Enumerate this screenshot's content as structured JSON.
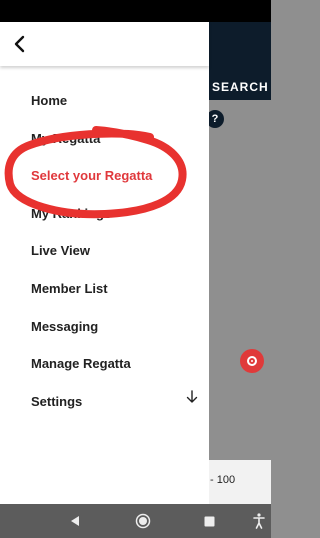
{
  "background": {
    "search_label": "SEARCH",
    "help_icon_text": "?",
    "scale_label": "- 100",
    "accent_color": "#e03a3a",
    "header_color": "#0d1c2b"
  },
  "drawer": {
    "back_icon": "chevron-left-icon",
    "items": [
      {
        "label": "Home"
      },
      {
        "label": "My Regatta"
      },
      {
        "label": "Select your Regatta",
        "active": true
      },
      {
        "label": "My Rankings"
      },
      {
        "label": "Live View"
      },
      {
        "label": "Member List"
      },
      {
        "label": "Messaging"
      },
      {
        "label": "Manage Regatta"
      },
      {
        "label": "Settings",
        "icon": "arrow-down-icon"
      }
    ]
  },
  "nav_bar": {
    "buttons": [
      "back-triangle-icon",
      "home-circle-icon",
      "recents-square-icon",
      "accessibility-icon"
    ]
  }
}
